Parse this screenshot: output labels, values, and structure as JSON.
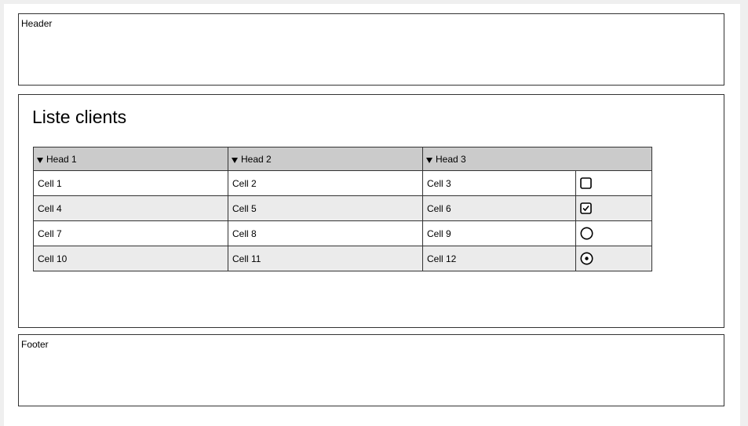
{
  "header": {
    "label": "Header"
  },
  "main": {
    "title": "Liste clients",
    "table": {
      "columns": [
        {
          "label": "Head 1",
          "icon": "sort-desc-icon"
        },
        {
          "label": "Head 2",
          "icon": "sort-desc-icon"
        },
        {
          "label": "Head 3",
          "icon": "sort-desc-icon"
        }
      ],
      "rows": [
        {
          "cells": [
            "Cell 1",
            "Cell 2",
            "Cell 3"
          ],
          "control": "checkbox",
          "checked": false
        },
        {
          "cells": [
            "Cell 4",
            "Cell 5",
            "Cell 6"
          ],
          "control": "checkbox",
          "checked": true
        },
        {
          "cells": [
            "Cell 7",
            "Cell 8",
            "Cell 9"
          ],
          "control": "radio",
          "checked": false
        },
        {
          "cells": [
            "Cell 10",
            "Cell 11",
            "Cell 12"
          ],
          "control": "radio",
          "checked": true
        }
      ]
    }
  },
  "footer": {
    "label": "Footer"
  }
}
